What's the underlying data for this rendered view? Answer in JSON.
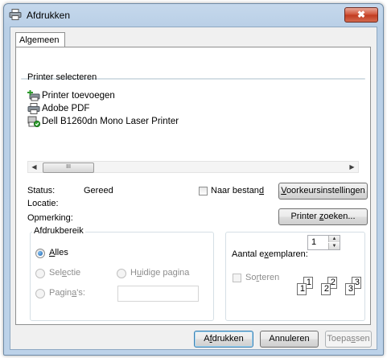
{
  "window": {
    "title": "Afdrukken",
    "close_symbol": "✖",
    "icon": "printer-icon"
  },
  "tabs": [
    {
      "label": "Algemeen",
      "selected": true
    }
  ],
  "printer_select": {
    "group_label": "Printer selecteren",
    "printers": [
      {
        "name": "Printer toevoegen",
        "icon": "add-printer-icon"
      },
      {
        "name": "Adobe PDF",
        "icon": "printer-icon"
      },
      {
        "name": "Dell B1260dn Mono Laser Printer",
        "icon": "default-printer-icon",
        "default": true
      }
    ],
    "scroll_left": "◀",
    "scroll_right": "▶",
    "scroll_grip": "III"
  },
  "printer_info": {
    "status_label": "Status:",
    "status_value": "Gereed",
    "location_label": "Locatie:",
    "location_value": "",
    "comment_label": "Opmerking:",
    "comment_value": "",
    "print_to_file_label_pre": "Naar bestan",
    "print_to_file_label_ul": "d",
    "print_to_file_checked": false,
    "preferences_button_ul": "V",
    "preferences_button_rest": "oorkeursinstellingen",
    "find_printer_pre": "Printer ",
    "find_printer_ul": "z",
    "find_printer_rest": "oeken..."
  },
  "page_range": {
    "group_label": "Afdrukbereik",
    "all_ul": "A",
    "all_rest": "lles",
    "all_checked": true,
    "selection_pre": "Sel",
    "selection_ul": "e",
    "selection_rest": "ctie",
    "current_page_pre": "H",
    "current_page_ul": "u",
    "current_page_rest": "idige pagina",
    "pages_pre": "Pagin",
    "pages_ul": "a",
    "pages_rest": "'s:",
    "pages_value": ""
  },
  "copies": {
    "label_pre": "Aantal e",
    "label_ul": "x",
    "label_rest": "emplaren:",
    "value": "1",
    "collate_pre": "So",
    "collate_ul": "r",
    "collate_rest": "teren",
    "collate_checked": false,
    "collate_pages": [
      "1",
      "1",
      "2",
      "2",
      "3",
      "3"
    ]
  },
  "footer": {
    "print_pre": "A",
    "print_ul": "f",
    "print_rest": "drukken",
    "cancel": "Annuleren",
    "apply_pre": "Toepa",
    "apply_ul": "s",
    "apply_rest": "sen"
  }
}
